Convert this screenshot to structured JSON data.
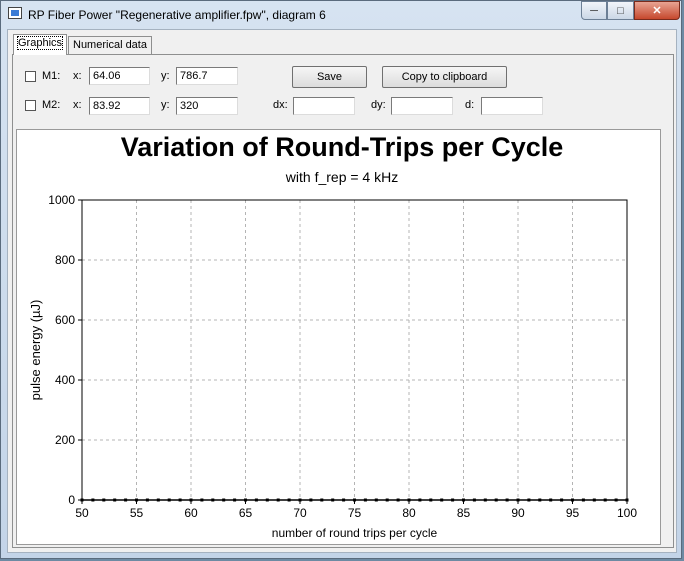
{
  "window": {
    "title": "RP Fiber Power \"Regenerative amplifier.fpw\", diagram 6",
    "minimize_icon": "minimize-icon",
    "maximize_icon": "maximize-icon",
    "close_icon": "close-icon"
  },
  "tabs": [
    {
      "label": "Graphics",
      "active": true
    },
    {
      "label": "Numerical data",
      "active": false
    }
  ],
  "markers": {
    "m1": {
      "label": "M1:",
      "x_label": "x:",
      "x_value": "64.06",
      "y_label": "y:",
      "y_value": "786.7",
      "checked": false
    },
    "m2": {
      "label": "M2:",
      "x_label": "x:",
      "x_value": "83.92",
      "y_label": "y:",
      "y_value": "320",
      "checked": false
    }
  },
  "deltas": {
    "dx_label": "dx:",
    "dx_value": "",
    "dy_label": "dy:",
    "dy_value": "",
    "d_label": "d:",
    "d_value": ""
  },
  "buttons": {
    "save_label": "Save",
    "copy_label": "Copy to clipboard"
  },
  "chart_data": {
    "type": "line",
    "title": "Variation of Round-Trips per Cycle",
    "subtitle": "with f_rep = 4 kHz",
    "xlabel": "number of round trips per cycle",
    "ylabel": "pulse energy (µJ)",
    "xlim": [
      50,
      100
    ],
    "ylim": [
      0,
      1000
    ],
    "xticks": [
      50,
      55,
      60,
      65,
      70,
      75,
      80,
      85,
      90,
      95,
      100
    ],
    "yticks": [
      0,
      200,
      400,
      600,
      800,
      1000
    ],
    "grid": true,
    "series": [
      {
        "color": "#000000",
        "marker": "square",
        "x": [
          50,
          51,
          52,
          53,
          54,
          55,
          56,
          57,
          58,
          59,
          60,
          61,
          62,
          63,
          64,
          65,
          66,
          67,
          68,
          69,
          70,
          71,
          72,
          73,
          74,
          75,
          76,
          77,
          78,
          79,
          80,
          81,
          82,
          83,
          84,
          85,
          86,
          87,
          88,
          89,
          90,
          91,
          92,
          93,
          94,
          95,
          96,
          97,
          98,
          99,
          100
        ],
        "y": [
          0,
          0,
          0,
          0,
          0,
          0,
          0,
          0,
          0,
          0,
          0,
          0,
          0,
          0,
          0,
          0,
          0,
          0,
          0,
          0,
          0,
          0,
          0,
          0,
          0,
          0,
          0,
          0,
          0,
          0,
          0,
          0,
          0,
          0,
          0,
          0,
          0,
          0,
          0,
          0,
          0,
          0,
          0,
          0,
          0,
          0,
          0,
          0,
          0,
          0,
          0
        ]
      }
    ]
  }
}
